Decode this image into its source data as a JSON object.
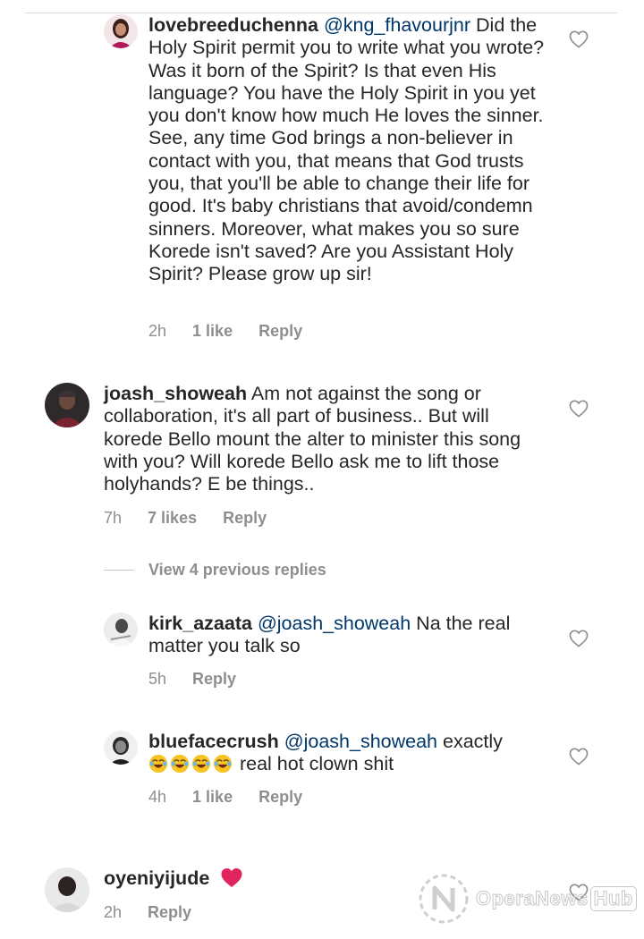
{
  "comments": [
    {
      "username": "lovebreeduchenna",
      "mention": "@kng_fhavourjnr",
      "text": "Did the Holy Spirit permit you to write what you wrote? Was it born of the Spirit? Is that even His language? You have the Holy Spirit in you yet you don't know how much He loves the sinner. See, any time God brings a non-believer in contact with you, that means that God trusts you, that you'll be able to change their life for good. It's baby christians that avoid/condemn sinners. Moreover, what makes you so sure Korede isn't saved? Are you Assistant Holy Spirit? Please grow up sir!",
      "time": "2h",
      "likes": "1 like",
      "reply": "Reply"
    },
    {
      "username": "joash_showeah",
      "text": "Am not against the song or collaboration, it's all part of business.. But will korede Bello mount the alter to minister this song with you? Will korede Bello ask me to lift those holyhands? E be things..",
      "time": "7h",
      "likes": "7 likes",
      "reply": "Reply"
    },
    {
      "username": "kirk_azaata",
      "mention": "@joash_showeah",
      "text": "Na the real matter you talk so",
      "time": "5h",
      "reply": "Reply"
    },
    {
      "username": "bluefacecrush",
      "mention": "@joash_showeah",
      "text": "exactly",
      "emoji_text": "real hot clown shit",
      "emoji_count": 4,
      "time": "4h",
      "likes": "1 like",
      "reply": "Reply"
    },
    {
      "username": "oyeniyijude",
      "time": "2h",
      "reply": "Reply"
    }
  ],
  "view_replies": "View 4 previous replies",
  "icons": {
    "like": "heart-outline-icon",
    "emoji": "rolling-on-floor-laughing-emoji",
    "red_heart": "red-heart-emoji"
  },
  "colors": {
    "text": "#262626",
    "meta": "#8e8e8e",
    "mention": "#00376b",
    "red_heart": "#e0245e"
  },
  "watermark": {
    "brand": "OperaNews",
    "suffix": "Hub"
  }
}
